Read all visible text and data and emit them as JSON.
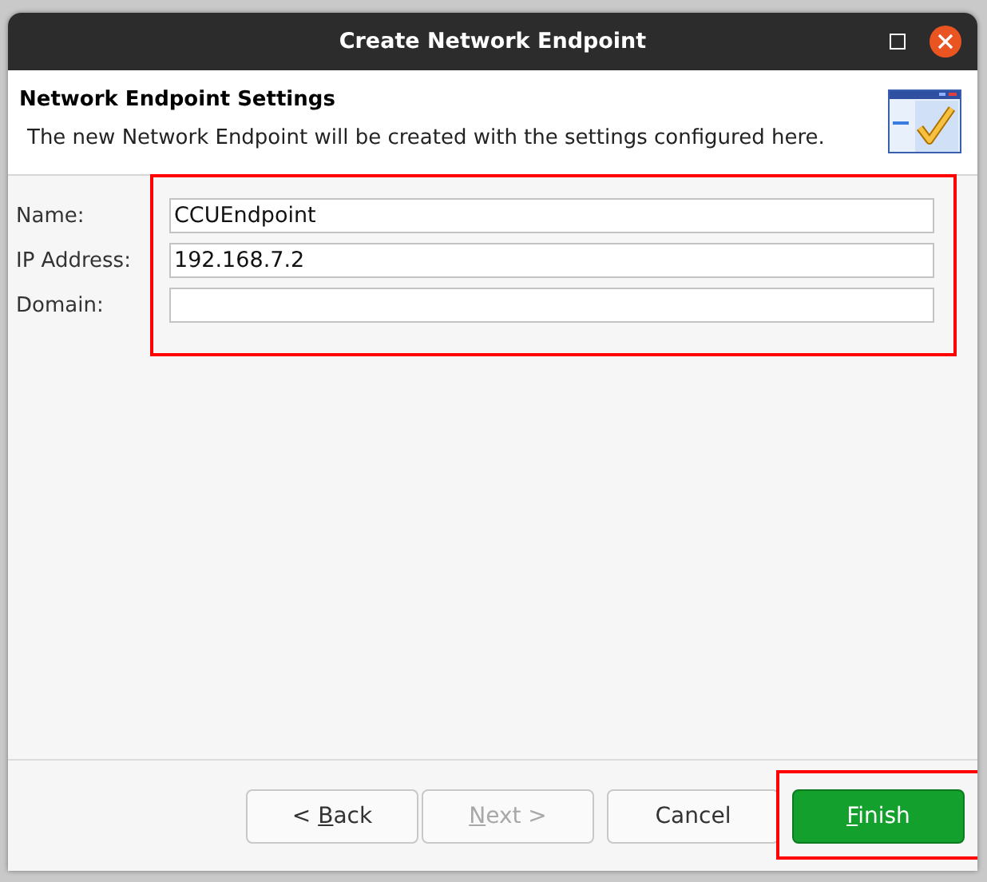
{
  "window": {
    "title": "Create Network Endpoint"
  },
  "header": {
    "title": "Network Endpoint Settings",
    "description": "The new Network Endpoint will be created with the settings configured here."
  },
  "form": {
    "highlighted": true,
    "fields": [
      {
        "label": "Name:",
        "value": "CCUEndpoint"
      },
      {
        "label": "IP Address:",
        "value": "192.168.7.2"
      },
      {
        "label": "Domain:"
      }
    ]
  },
  "buttons": [
    {
      "kind": "normal",
      "prefix": "< ",
      "accel": "B",
      "rest": "ack",
      "disabled": false,
      "highlighted": false
    },
    {
      "kind": "normal",
      "accel": "N",
      "rest": "ext >",
      "disabled": true,
      "highlighted": false
    },
    {
      "kind": "normal",
      "rest": "Cancel",
      "disabled": false,
      "highlighted": false
    },
    {
      "kind": "primary",
      "accel": "F",
      "rest": "inish",
      "disabled": false,
      "highlighted": true
    }
  ]
}
